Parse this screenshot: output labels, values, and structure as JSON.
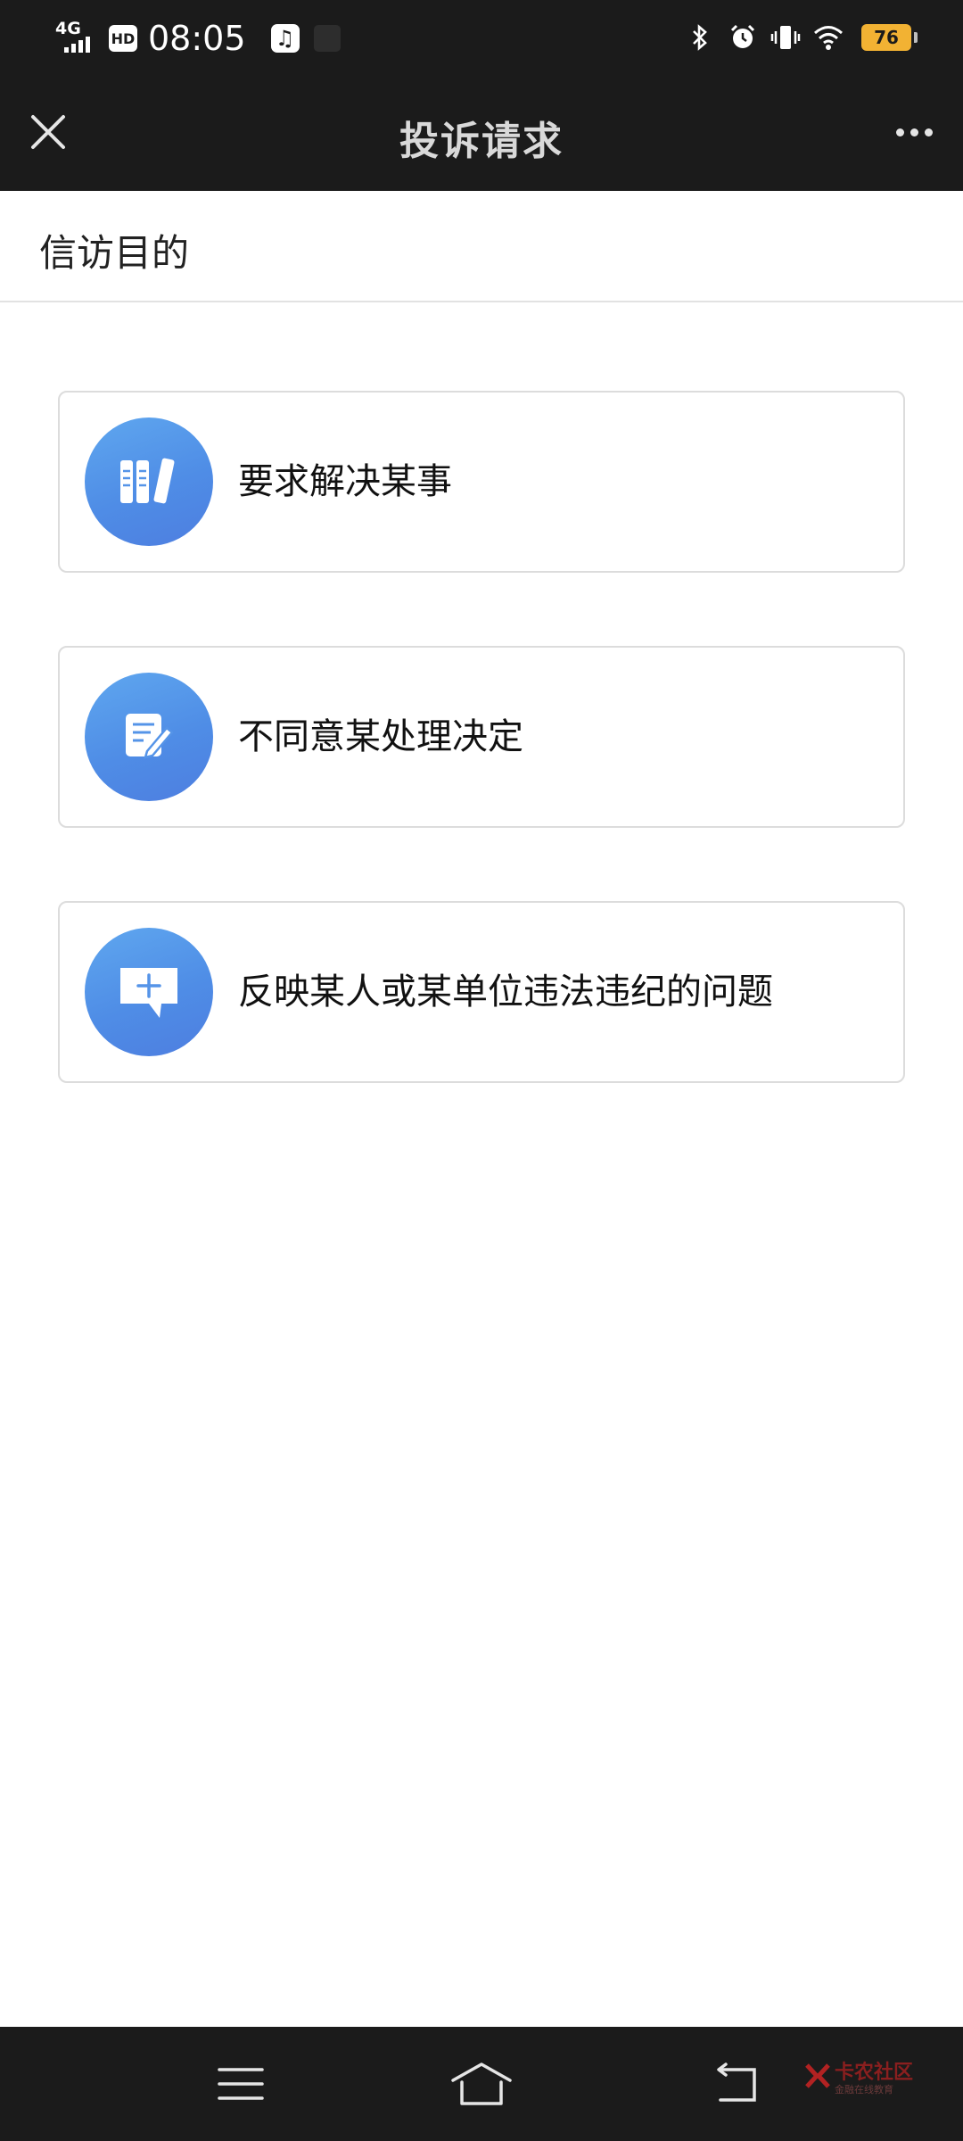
{
  "status_bar": {
    "network": "4G",
    "hd_badge": "HD",
    "time": "08:05",
    "battery": "76",
    "icons": [
      "signal-icon",
      "hd-icon",
      "music-icon",
      "bluetooth-icon",
      "alarm-icon",
      "vibrate-icon",
      "wifi-icon",
      "battery-icon"
    ]
  },
  "title_bar": {
    "title": "投诉请求",
    "close_icon": "close-icon",
    "more_icon": "more-icon"
  },
  "section": {
    "title": "信访目的"
  },
  "options": [
    {
      "label": "要求解决某事",
      "icon": "books-icon"
    },
    {
      "label": "不同意某处理决定",
      "icon": "edit-document-icon"
    },
    {
      "label": "反映某人或某单位违法违纪的问题",
      "icon": "add-comment-icon"
    }
  ],
  "nav_bar": {
    "icons": [
      "menu-icon",
      "home-icon",
      "back-icon"
    ],
    "watermark": {
      "main": "卡农社区",
      "sub": "金融在线教育"
    }
  },
  "colors": {
    "bar_background": "#1b1b1b",
    "icon_gradient_start": "#5fa7ef",
    "icon_gradient_end": "#4d7ee0",
    "battery": "#f2b233",
    "card_border": "#dcdcdc"
  }
}
